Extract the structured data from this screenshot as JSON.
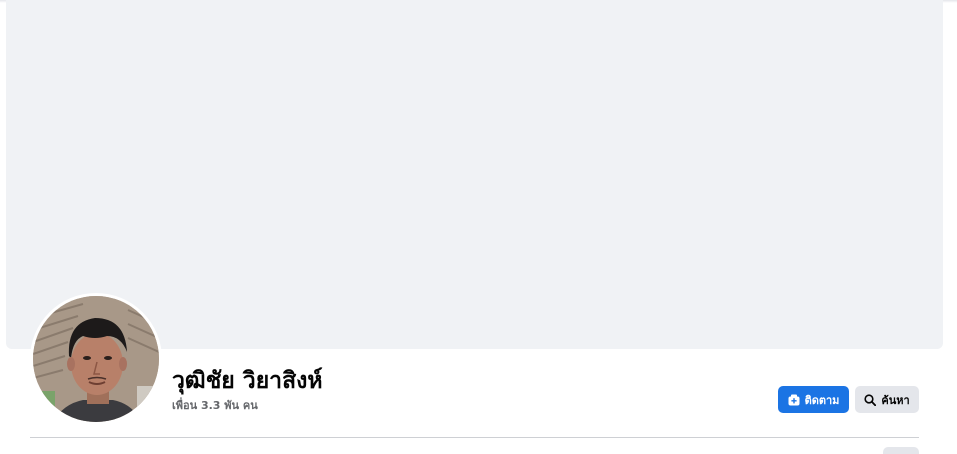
{
  "profile": {
    "name": "วุฒิชัย วิยาสิงห์",
    "friends_count": "เพื่อน 3.3 พัน คน"
  },
  "actions": {
    "follow_label": "ติดตาม",
    "search_label": "ค้นหา"
  },
  "icons": {
    "follow": "follow-icon",
    "search": "search-icon",
    "more": "more-icon"
  },
  "colors": {
    "accent": "#1b74e4",
    "cover": "#f0f2f5",
    "secondary_button": "#e4e6eb",
    "text_primary": "#050505",
    "text_secondary": "#65676b"
  }
}
